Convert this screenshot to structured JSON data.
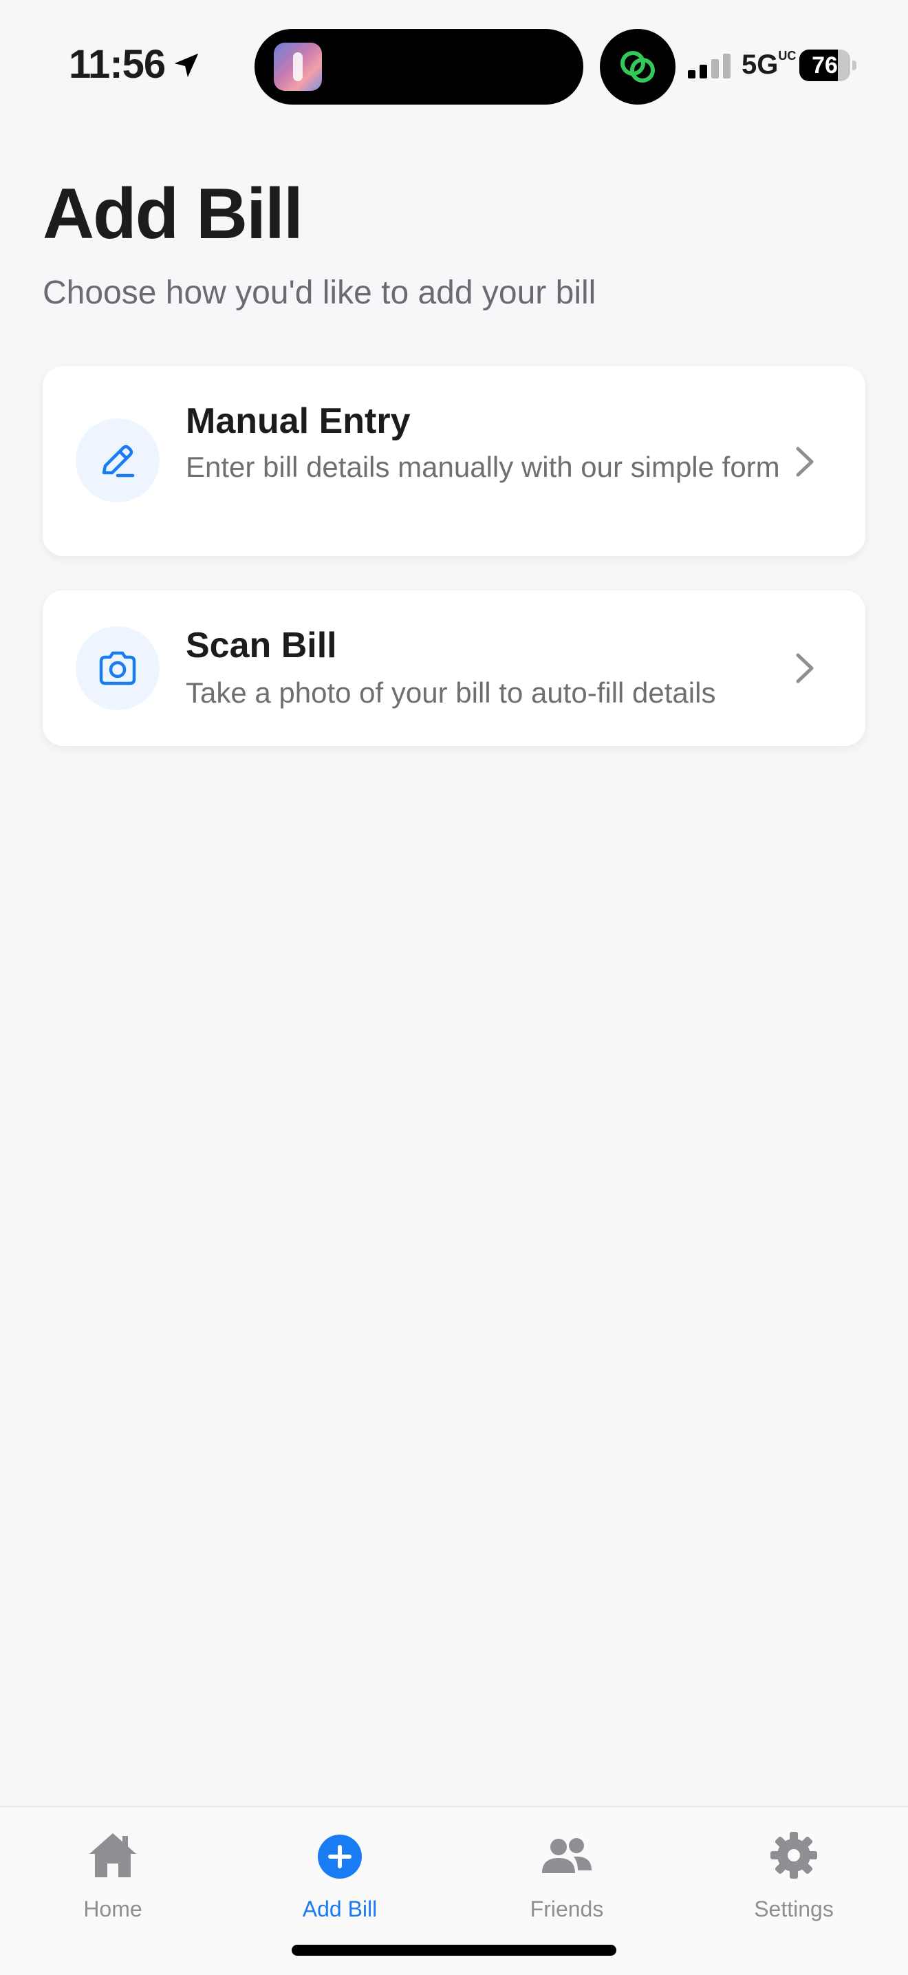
{
  "status_bar": {
    "time": "11:56",
    "network": "5G",
    "network_suffix": "UC",
    "battery": "76",
    "battery_level": 0.76
  },
  "header": {
    "title": "Add Bill",
    "subtitle": "Choose how you'd like to add your bill"
  },
  "options": [
    {
      "title": "Manual Entry",
      "description": "Enter bill details manually with our simple form",
      "icon": "pencil-icon"
    },
    {
      "title": "Scan Bill",
      "description": "Take a photo of your bill to auto-fill details",
      "icon": "camera-icon"
    }
  ],
  "tab_bar": {
    "tabs": [
      {
        "label": "Home",
        "icon": "home-icon",
        "active": false
      },
      {
        "label": "Add Bill",
        "icon": "plus-circle-icon",
        "active": true
      },
      {
        "label": "Friends",
        "icon": "people-icon",
        "active": false
      },
      {
        "label": "Settings",
        "icon": "gear-icon",
        "active": false
      }
    ]
  },
  "colors": {
    "accent": "#1a7cf2",
    "background": "#f6f7f9",
    "card": "#ffffff",
    "inactive": "#8e8e93"
  }
}
